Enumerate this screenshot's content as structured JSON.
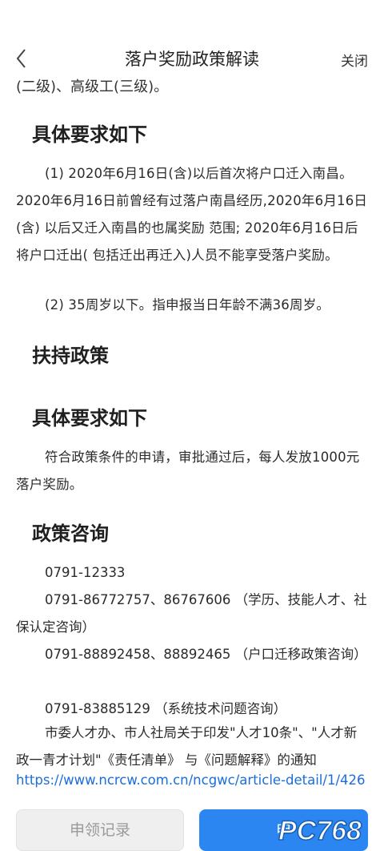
{
  "header": {
    "title": "落户奖励政策解读",
    "close_label": "关闭"
  },
  "content": {
    "cut_line": "(二级)、高级工(三级)。",
    "section1_title": "具体要求如下",
    "req1": "(1) 2020年6月16日(含)以后首次将户口迁入南昌。2020年6月16日前曾经有过落户南昌经历,2020年6月16日(含) 以后又迁入南昌的也属奖励 范围; 2020年6月16日后将户口迁出( 包括迁出再迁入)人员不能享受落户奖励。",
    "req2": "(2) 35周岁以下。指申报当日年龄不满36周岁。",
    "section2_title": "扶持政策",
    "section3_title": "具体要求如下",
    "support_text": "符合政策条件的申请，审批通过后，每人发放1000元落户奖励。",
    "section4_title": "政策咨询",
    "phone1": "0791-12333",
    "phone2": "0791-86772757、86767606 （学历、技能人才、社保认定咨询）",
    "phone3": "0791-88892458、88892465 （户口迁移政策咨询）",
    "phone4": "0791-83885129 （系统技术问题咨询）",
    "notice": "市委人才办、市人社局关于印发\"人才10条\"、\"人才新政一青才计划\"《责任清单》 与《问题解释》的通知",
    "link": "https://www.ncrcw.com.cn/ncgwc/article-detail/1/426"
  },
  "footer": {
    "left_button": "申领记录",
    "right_button": "申"
  },
  "watermark": "PC768",
  "colors": {
    "primary": "#2b86f1",
    "link": "#1a6ddc",
    "disabled_bg": "#efefef"
  }
}
